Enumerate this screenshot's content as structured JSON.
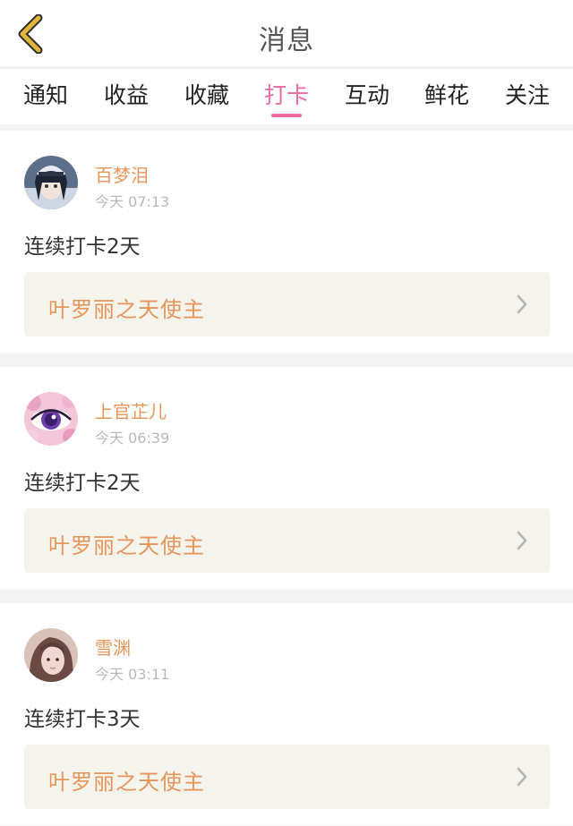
{
  "header": {
    "title": "消息"
  },
  "tabs": [
    {
      "label": "通知"
    },
    {
      "label": "收益"
    },
    {
      "label": "收藏"
    },
    {
      "label": "打卡",
      "active": true
    },
    {
      "label": "互动"
    },
    {
      "label": "鲜花"
    },
    {
      "label": "关注"
    }
  ],
  "colors": {
    "accent_pink": "#e86aa0",
    "name_orange": "#e8955a",
    "back_yellow": "#e2b63a"
  },
  "cards": [
    {
      "username": "百梦泪",
      "time": "今天 07:13",
      "message": "连续打卡2天",
      "link": "叶罗丽之天使主",
      "avatar": "avatar-girl-cap"
    },
    {
      "username": "上官芷儿",
      "time": "今天 06:39",
      "message": "连续打卡2天",
      "link": "叶罗丽之天使主",
      "avatar": "avatar-eye-flowers"
    },
    {
      "username": "雪渊",
      "time": "今天 03:11",
      "message": "连续打卡3天",
      "link": "叶罗丽之天使主",
      "avatar": "avatar-girl-portrait"
    }
  ]
}
